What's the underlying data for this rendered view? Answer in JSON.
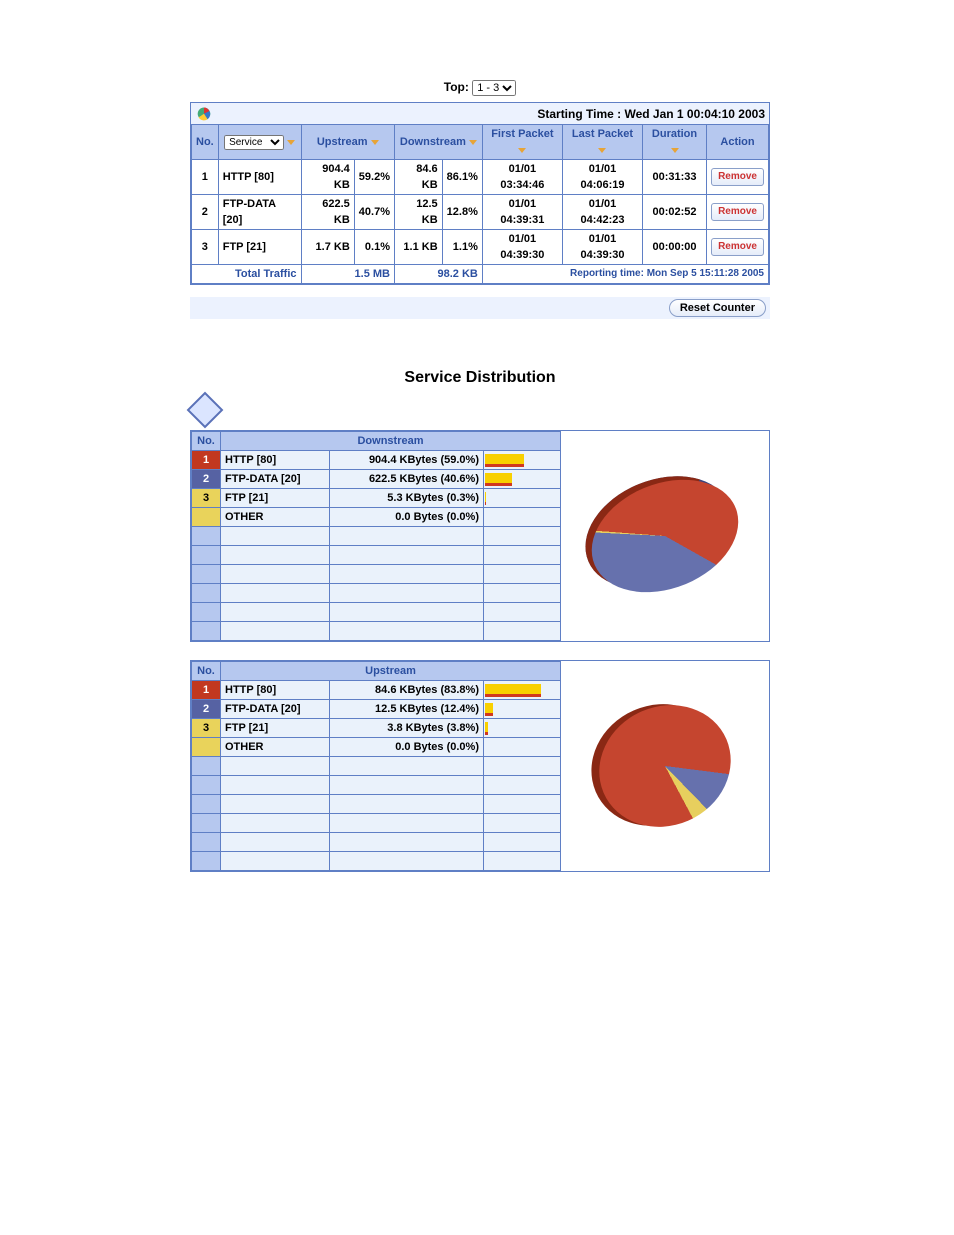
{
  "top": {
    "label": "Top:",
    "selected": "1 - 3"
  },
  "starting_time_label": "Starting Time : Wed Jan 1 00:04:10 2003",
  "main_table": {
    "headers": {
      "no": "No.",
      "service_select": "Service",
      "upstream": "Upstream",
      "downstream": "Downstream",
      "first_packet": "First Packet",
      "last_packet": "Last Packet",
      "duration": "Duration",
      "action": "Action"
    },
    "rows": [
      {
        "no": "1",
        "service": "HTTP [80]",
        "up_size": "904.4 KB",
        "up_pct": "59.2%",
        "down_size": "84.6 KB",
        "down_pct": "86.1%",
        "first": "01/01 03:34:46",
        "last": "01/01 04:06:19",
        "dur": "00:31:33",
        "action": "Remove"
      },
      {
        "no": "2",
        "service": "FTP-DATA [20]",
        "up_size": "622.5 KB",
        "up_pct": "40.7%",
        "down_size": "12.5 KB",
        "down_pct": "12.8%",
        "first": "01/01 04:39:31",
        "last": "01/01 04:42:23",
        "dur": "00:02:52",
        "action": "Remove"
      },
      {
        "no": "3",
        "service": "FTP [21]",
        "up_size": "1.7 KB",
        "up_pct": "0.1%",
        "down_size": "1.1 KB",
        "down_pct": "1.1%",
        "first": "01/01 04:39:30",
        "last": "01/01 04:39:30",
        "dur": "00:00:00",
        "action": "Remove"
      }
    ],
    "total": {
      "label": "Total Traffic",
      "upstream": "1.5 MB",
      "downstream": "98.2 KB",
      "reporting": "Reporting time: Mon Sep 5 15:11:28 2005"
    }
  },
  "reset_label": "Reset Counter",
  "dist_title": "Service Distribution",
  "dist_headers": {
    "no": "No.",
    "downstream": "Downstream",
    "upstream": "Upstream"
  },
  "downstream_rows": [
    {
      "no": "1",
      "service": "HTTP [80]",
      "value": "904.4 KBytes (59.0%)",
      "pct": 59.0,
      "cls": "no-1"
    },
    {
      "no": "2",
      "service": "FTP-DATA [20]",
      "value": "622.5 KBytes (40.6%)",
      "pct": 40.6,
      "cls": "no-2"
    },
    {
      "no": "3",
      "service": "FTP [21]",
      "value": "5.3 KBytes (0.3%)",
      "pct": 0.3,
      "cls": "no-3"
    },
    {
      "no": "",
      "service": "OTHER",
      "value": "0.0 Bytes (0.0%)",
      "pct": 0.0,
      "cls": "no-x"
    }
  ],
  "upstream_rows": [
    {
      "no": "1",
      "service": "HTTP [80]",
      "value": "84.6 KBytes (83.8%)",
      "pct": 83.8,
      "cls": "no-1"
    },
    {
      "no": "2",
      "service": "FTP-DATA [20]",
      "value": "12.5 KBytes (12.4%)",
      "pct": 12.4,
      "cls": "no-2"
    },
    {
      "no": "3",
      "service": "FTP [21]",
      "value": "3.8 KBytes (3.8%)",
      "pct": 3.8,
      "cls": "no-3"
    },
    {
      "no": "",
      "service": "OTHER",
      "value": "0.0 Bytes (0.0%)",
      "pct": 0.0,
      "cls": "no-x"
    }
  ],
  "chart_data": [
    {
      "type": "pie",
      "title": "Downstream",
      "categories": [
        "HTTP [80]",
        "FTP-DATA [20]",
        "FTP [21]",
        "OTHER"
      ],
      "values": [
        59.0,
        40.6,
        0.3,
        0.0
      ],
      "colors": [
        "#c5452f",
        "#6671ad",
        "#e7cf5e",
        "#e7cf5e"
      ]
    },
    {
      "type": "pie",
      "title": "Upstream",
      "categories": [
        "HTTP [80]",
        "FTP-DATA [20]",
        "FTP [21]",
        "OTHER"
      ],
      "values": [
        83.8,
        12.4,
        3.8,
        0.0
      ],
      "colors": [
        "#c5452f",
        "#6671ad",
        "#e7cf5e",
        "#e7cf5e"
      ]
    }
  ]
}
